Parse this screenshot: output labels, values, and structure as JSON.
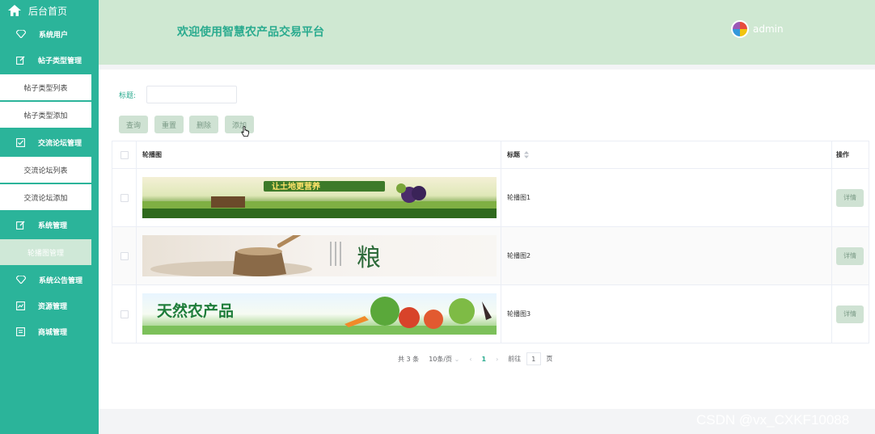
{
  "sidebar": {
    "home_label": "后台首页",
    "menu": [
      {
        "type": "head",
        "label": "系统用户",
        "icon": "diamond-icon"
      },
      {
        "type": "head",
        "label": "帖子类型管理",
        "icon": "edit-icon"
      },
      {
        "type": "sub",
        "label": "帖子类型列表"
      },
      {
        "type": "sub",
        "label": "帖子类型添加"
      },
      {
        "type": "head",
        "label": "交流论坛管理",
        "icon": "checkbox-icon"
      },
      {
        "type": "sub",
        "label": "交流论坛列表"
      },
      {
        "type": "sub",
        "label": "交流论坛添加"
      },
      {
        "type": "head",
        "label": "系统管理",
        "icon": "edit-icon"
      },
      {
        "type": "sub",
        "label": "轮播图管理",
        "active": true
      },
      {
        "type": "head",
        "label": "系统公告管理",
        "icon": "diamond-icon"
      },
      {
        "type": "head",
        "label": "资源管理",
        "icon": "chart-icon"
      },
      {
        "type": "head",
        "label": "商城管理",
        "icon": "doc-icon"
      }
    ]
  },
  "header": {
    "title": "欢迎使用智慧农产品交易平台",
    "username": "admin"
  },
  "search": {
    "label": "标题:",
    "value": ""
  },
  "toolbar": {
    "query_label": "查询",
    "reset_label": "重置",
    "delete_label": "删除",
    "add_label": "添加"
  },
  "table": {
    "headers": {
      "image": "轮播图",
      "title": "标题",
      "op": "操作"
    },
    "rows": [
      {
        "title": "轮播图1",
        "detail": "详情"
      },
      {
        "title": "轮播图2",
        "detail": "详情"
      },
      {
        "title": "轮播图3",
        "detail": "详情"
      }
    ]
  },
  "pagination": {
    "total": "共 3 条",
    "page_size": "10条/页",
    "current": "1",
    "goto_prefix": "前往",
    "goto_value": "1",
    "goto_suffix": "页"
  },
  "banner_texts": {
    "b1": "让土地更营养",
    "b2": "粮",
    "b3": "天然农产品"
  },
  "watermark": "CSDN @vx_CXKF10088",
  "colors": {
    "accent": "#2bb49a",
    "header": "#cfe8d2",
    "button": "#cfe2d3"
  }
}
